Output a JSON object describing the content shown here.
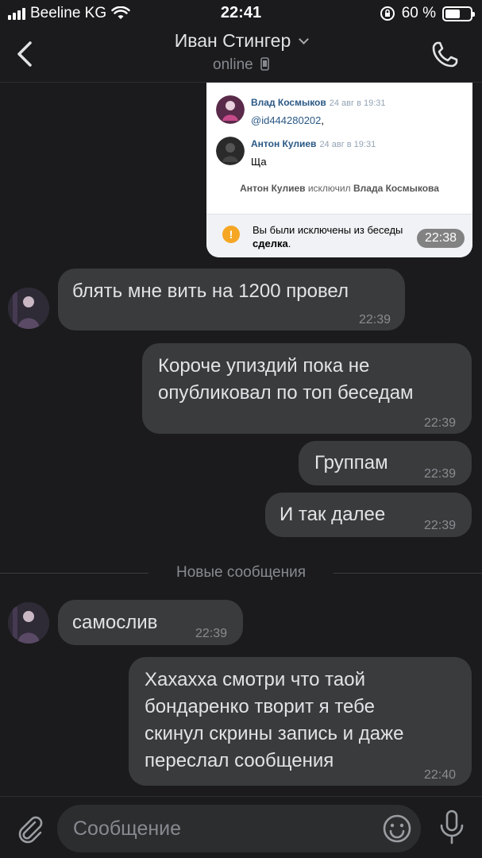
{
  "status_bar": {
    "carrier": "Beeline KG",
    "time": "22:41",
    "battery": "60 %"
  },
  "header": {
    "name": "Иван Стингер",
    "status": "online"
  },
  "screenshot": {
    "msg1": {
      "name": "Влад Космыков",
      "date": "24 авг в 19:31",
      "text": "@id444280202",
      "text_suffix": ","
    },
    "msg2": {
      "name": "Антон Кулиев",
      "date": "24 авг в 19:31",
      "text": "Ща"
    },
    "service": {
      "actor": "Антон Кулиев",
      "action": "исключил",
      "target": "Влада Космыкова"
    },
    "notice": {
      "text": "Вы были исключены из беседы",
      "chat": "сделка",
      "suffix": "."
    },
    "time": "22:38"
  },
  "messages": [
    {
      "text": "блять мне вить на 1200 провел",
      "time": "22:39"
    },
    {
      "text_lines": [
        "Короче упиздий пока не",
        "опубликовал по топ беседам"
      ],
      "time": "22:39"
    },
    {
      "text": "Группам",
      "time": "22:39"
    },
    {
      "text": "И так далее",
      "time": "22:39"
    },
    {
      "text": "самослив",
      "time": "22:39"
    },
    {
      "text_lines": [
        "Хахахха смотри что таой",
        "бондаренко творит я тебе",
        "скинул скрины запись и даже",
        "переслал сообщения"
      ],
      "time": "22:40"
    }
  ],
  "divider": "Новые сообщения",
  "composer": {
    "placeholder": "Сообщение"
  },
  "colors": {
    "background": "#1b1b1d",
    "bubble": "#3a3b3d",
    "link": "#2a5885",
    "warning": "#f5a623"
  }
}
